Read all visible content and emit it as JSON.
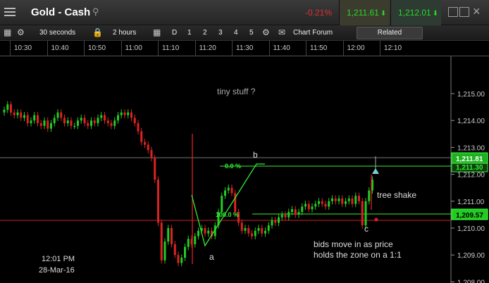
{
  "titlebar": {
    "title": "Gold - Cash",
    "change": "-0.21%",
    "bid": "1,211.61",
    "ask": "1,212.01"
  },
  "toolbar": {
    "interval": "30 seconds",
    "range": "2 hours",
    "day": "D",
    "nums": [
      "1",
      "2",
      "3",
      "4",
      "5"
    ],
    "chart_forum": "Chart Forum",
    "related": "Related"
  },
  "time_axis": [
    "10:30",
    "10:40",
    "10:50",
    "11:00",
    "11:10",
    "11:20",
    "11:30",
    "11:40",
    "11:50",
    "12:00",
    "12:10"
  ],
  "price_axis": [
    "1,215.00",
    "1,214.00",
    "1,213.00",
    "1,212.00",
    "1,211.00",
    "1,210.00",
    "1,209.00",
    "1,208.00"
  ],
  "price_labels": {
    "current": "1,211.81",
    "behind": "1,211.30",
    "level": "1,209.57"
  },
  "annotations": {
    "tiny": "tiny stuff ?",
    "b": "b",
    "a": "a",
    "c": "c",
    "fib0": "0.0 %",
    "fib100": "100.0 %",
    "tree": "tree shake",
    "bids1": "bids move in as price",
    "bids2": "holds the zone on a  1:1",
    "time": "12:01 PM",
    "date": "28-Mar-16"
  },
  "colors": {
    "up": "#22cc22",
    "down": "#dd2222",
    "green_line": "#33ee33",
    "red_line": "#cc2222"
  },
  "icons": [
    "menu-icon",
    "search-icon",
    "gear-icon",
    "lock-icon",
    "calendar-icon",
    "chat-icon",
    "restore-icon",
    "maximize-icon",
    "close-icon"
  ]
}
